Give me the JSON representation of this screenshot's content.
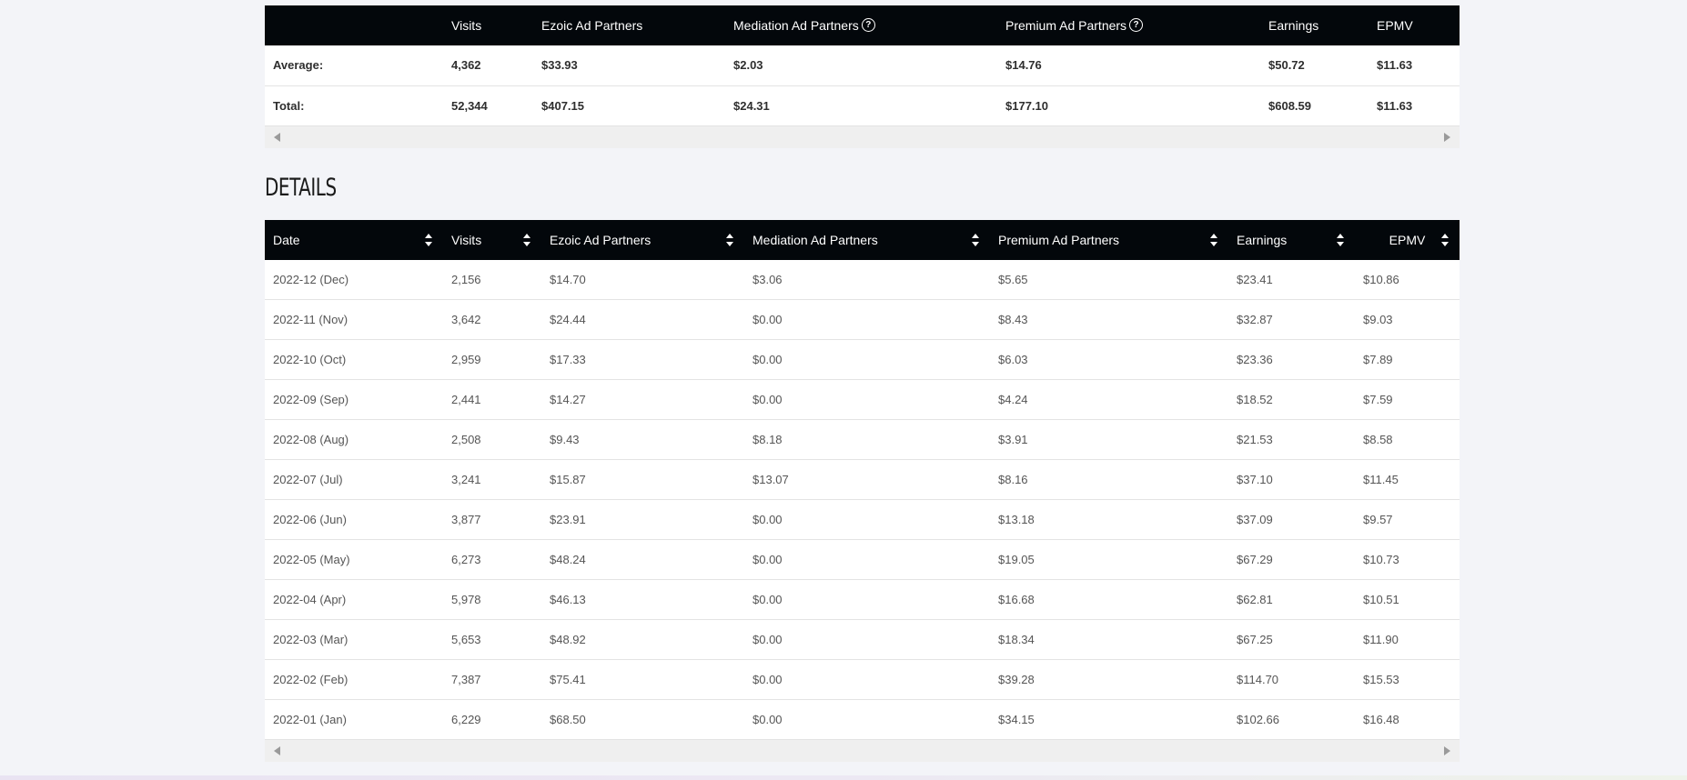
{
  "summary": {
    "headers": [
      "",
      "Visits",
      "Ezoic Ad Partners",
      "Mediation Ad Partners",
      "Premium Ad Partners",
      "Earnings",
      "EPMV"
    ],
    "rows": [
      [
        "Average:",
        "4,362",
        "$33.93",
        "$2.03",
        "$14.76",
        "$50.72",
        "$11.63"
      ],
      [
        "Total:",
        "52,344",
        "$407.15",
        "$24.31",
        "$177.10",
        "$608.59",
        "$11.63"
      ]
    ],
    "help_icon_glyph": "?"
  },
  "details": {
    "title": "DETAILS",
    "headers": [
      "Date",
      "Visits",
      "Ezoic Ad Partners",
      "Mediation Ad Partners",
      "Premium Ad Partners",
      "Earnings",
      "EPMV"
    ],
    "rows": [
      [
        "2022-12 (Dec)",
        "2,156",
        "$14.70",
        "$3.06",
        "$5.65",
        "$23.41",
        "$10.86"
      ],
      [
        "2022-11 (Nov)",
        "3,642",
        "$24.44",
        "$0.00",
        "$8.43",
        "$32.87",
        "$9.03"
      ],
      [
        "2022-10 (Oct)",
        "2,959",
        "$17.33",
        "$0.00",
        "$6.03",
        "$23.36",
        "$7.89"
      ],
      [
        "2022-09 (Sep)",
        "2,441",
        "$14.27",
        "$0.00",
        "$4.24",
        "$18.52",
        "$7.59"
      ],
      [
        "2022-08 (Aug)",
        "2,508",
        "$9.43",
        "$8.18",
        "$3.91",
        "$21.53",
        "$8.58"
      ],
      [
        "2022-07 (Jul)",
        "3,241",
        "$15.87",
        "$13.07",
        "$8.16",
        "$37.10",
        "$11.45"
      ],
      [
        "2022-06 (Jun)",
        "3,877",
        "$23.91",
        "$0.00",
        "$13.18",
        "$37.09",
        "$9.57"
      ],
      [
        "2022-05 (May)",
        "6,273",
        "$48.24",
        "$0.00",
        "$19.05",
        "$67.29",
        "$10.73"
      ],
      [
        "2022-04 (Apr)",
        "5,978",
        "$46.13",
        "$0.00",
        "$16.68",
        "$62.81",
        "$10.51"
      ],
      [
        "2022-03 (Mar)",
        "5,653",
        "$48.92",
        "$0.00",
        "$18.34",
        "$67.25",
        "$11.90"
      ],
      [
        "2022-02 (Feb)",
        "7,387",
        "$75.41",
        "$0.00",
        "$39.28",
        "$114.70",
        "$15.53"
      ],
      [
        "2022-01 (Jan)",
        "6,229",
        "$68.50",
        "$0.00",
        "$34.15",
        "$102.66",
        "$16.48"
      ]
    ]
  }
}
